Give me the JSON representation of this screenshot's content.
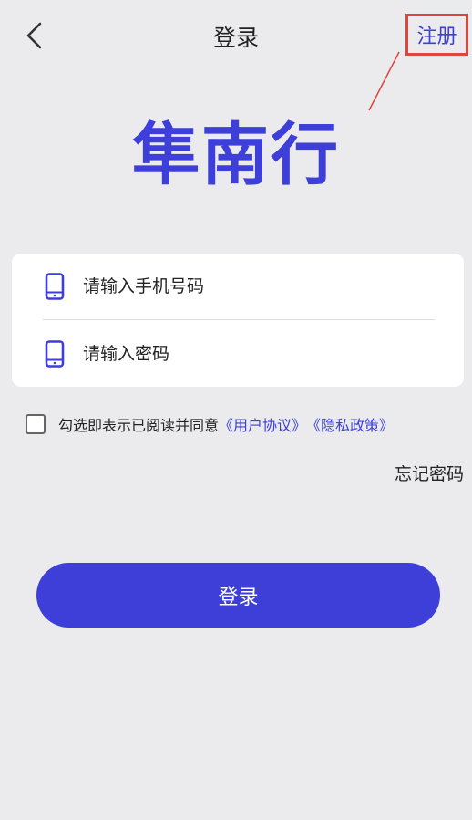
{
  "header": {
    "title": "登录",
    "register_label": "注册",
    "back_icon": "chevron-left-icon"
  },
  "logo": {
    "text": "隼南行"
  },
  "form": {
    "phone_placeholder": "请输入手机号码",
    "password_placeholder": "请输入密码",
    "field_icon": "phone-icon"
  },
  "agreement": {
    "checked": false,
    "text": "勾选即表示已阅读并同意",
    "user_agreement": "《用户协议》",
    "privacy_policy": "《隐私政策》"
  },
  "forgot_password": "忘记密码",
  "login_button": "登录",
  "colors": {
    "accent": "#3d3fd8",
    "background": "#ebebed",
    "highlight_box": "#e0453d"
  }
}
